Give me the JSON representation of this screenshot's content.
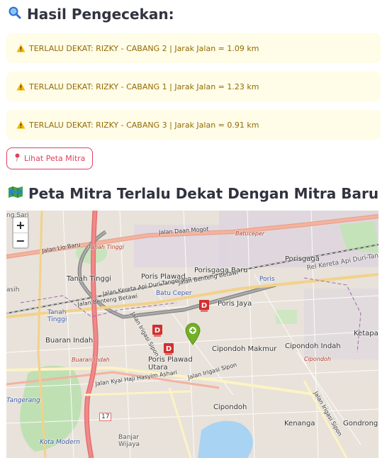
{
  "results_heading": {
    "icon": "magnifier-icon",
    "text": "Hasil Pengecekan:"
  },
  "alerts": [
    {
      "icon": "warning-icon",
      "text": "TERLALU DEKAT: RIZKY - CABANG 2 | Jarak Jalan = 1.09 km"
    },
    {
      "icon": "warning-icon",
      "text": "TERLALU DEKAT: RIZKY - CABANG 1 | Jarak Jalan = 1.23 km"
    },
    {
      "icon": "warning-icon",
      "text": "TERLALU DEKAT: RIZKY - CABANG 3 | Jarak Jalan = 0.91 km"
    }
  ],
  "map_button": {
    "icon": "pin-icon",
    "label": "Lihat Peta Mitra"
  },
  "map_heading": {
    "icon": "map-icon",
    "text": "Peta Mitra Terlalu Dekat Dengan Mitra Baru"
  },
  "map": {
    "zoom_in": "+",
    "zoom_out": "−",
    "labels": {
      "jalan_daan_mogot": "Jalan Daan Mogot",
      "jalan_lio_baru": "Jalan Lio Baru",
      "tanah_tinggi_top": "Tanah Tinggi",
      "batu_ceper_top": "Batuceper",
      "poris_plawad": "Poris Plawad",
      "porisgaga_baru": "Porisgaga Baru",
      "porisgaga": "Porisgaga",
      "poris": "Poris",
      "batu_ceper": "Batu Ceper",
      "poris_jaya": "Poris Jaya",
      "tanah_tinggi": "Tanah Tinggi",
      "tanah_tinggi_blue": "Tanah\nTinggi",
      "buaran_indah": "Buaran Indah",
      "buaran_indah_red": "Buaran Indah",
      "cipondoh_makmur": "Cipondoh Makmur",
      "cipondoh_indah": "Cipondoh Indah",
      "cipondoh_red": "Cipondoh",
      "ketapang": "Ketapar",
      "poris_plawad_utara": "Poris Plawad\nUtara",
      "jalan_benteng_betawi": "Jalan Benteng Betawi",
      "jalan_irigasi_sipon": "Jalan Irigasi Sipon",
      "jalan_kyai": "Jalan Kyai Haji Hasyim Ashari",
      "cipondoh": "Cipondoh",
      "kenanga": "Kenanga",
      "gondrong": "Gondrong",
      "tangerang": "Tangerang",
      "kota_modern": "Kota Modern",
      "banjar_wijaya": "Banjar\nWijaya",
      "sasi": "asih",
      "sari": "ng Sari",
      "rel_kereta": "Rel Kereta Api Duri-Tangerang",
      "jalan_kereta_top": "Jalan Kereta Api Duri-Tangerang",
      "route_17": "17"
    },
    "markers": [
      "mitra-d-marker",
      "mitra-d-marker",
      "mitra-d-marker",
      "new-mitra-pin"
    ]
  },
  "colors": {
    "warning_bg": "#fffce7",
    "warning_text": "#926c05",
    "accent": "#e1405f"
  }
}
